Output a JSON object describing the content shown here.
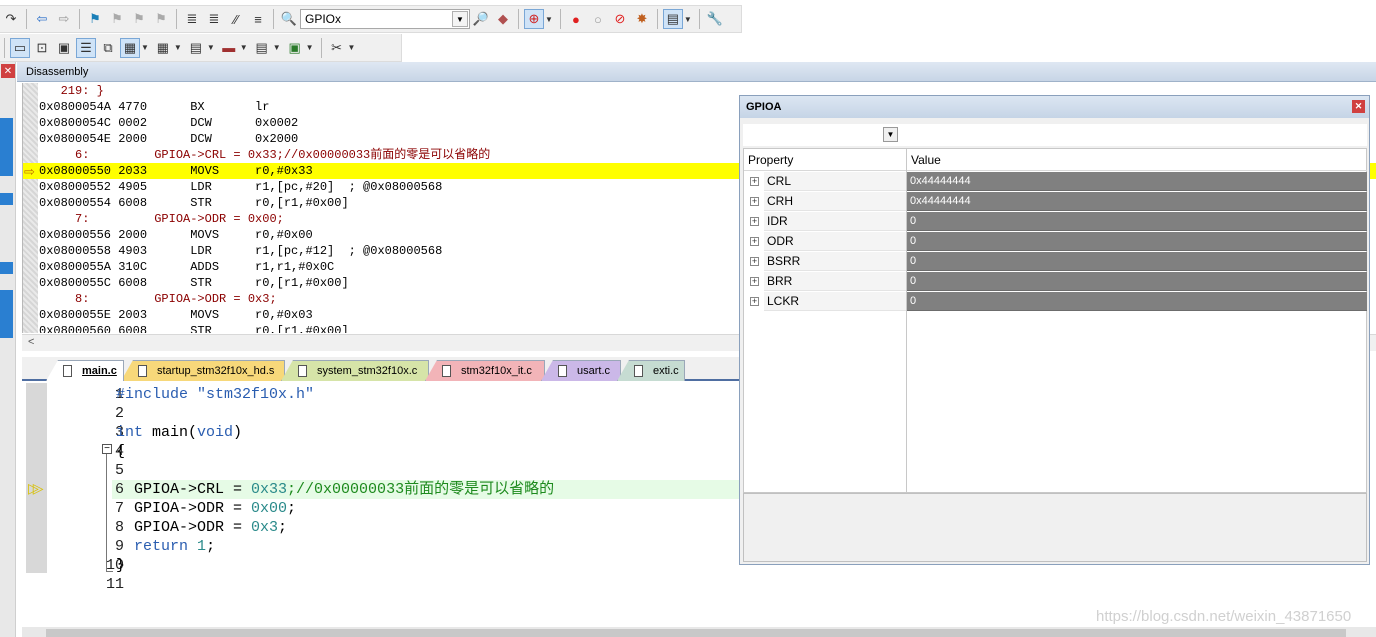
{
  "toolbar1": {
    "target_combo": "GPIOx",
    "icons": [
      "redo-icon",
      "back-icon",
      "forward-icon",
      "bookmark-icon",
      "prev-bookmark-icon",
      "next-bookmark-icon",
      "clear-bookmarks-icon",
      "indent-icon",
      "unindent-icon",
      "comment-icon",
      "uncomment-icon",
      "find-in-files-icon",
      "find-icon",
      "debug-session-icon",
      "breakpoint-icon",
      "disable-breakpoint-icon",
      "disable-all-breakpoints-icon",
      "kill-breakpoints-icon",
      "window-layout-icon",
      "configure-icon"
    ]
  },
  "toolbar2": {
    "icons": [
      "command-window-icon",
      "disassembly-window-icon",
      "symbols-window-icon",
      "registers-window-icon",
      "call-stack-icon",
      "watch-window-icon",
      "memory-window-icon",
      "serial-window-icon",
      "analysis-window-icon",
      "trace-window-icon",
      "system-viewer-icon",
      "toolbox-icon"
    ]
  },
  "disassembly": {
    "title": "Disassembly",
    "lines": [
      {
        "text": "   219: }",
        "kind": "src"
      },
      {
        "text": "0x0800054A 4770      BX       lr",
        "kind": "asm"
      },
      {
        "text": "0x0800054C 0002      DCW      0x0002",
        "kind": "asm"
      },
      {
        "text": "0x0800054E 2000      DCW      0x2000",
        "kind": "asm"
      },
      {
        "text": "     6:         GPIOA->CRL = 0x33;//0x00000033前面的零是可以省略的",
        "kind": "src"
      },
      {
        "text": "0x08000550 2033      MOVS     r0,#0x33",
        "kind": "cur"
      },
      {
        "text": "0x08000552 4905      LDR      r1,[pc,#20]  ; @0x08000568",
        "kind": "asm"
      },
      {
        "text": "0x08000554 6008      STR      r0,[r1,#0x00]",
        "kind": "asm"
      },
      {
        "text": "     7:         GPIOA->ODR = 0x00;",
        "kind": "src"
      },
      {
        "text": "0x08000556 2000      MOVS     r0,#0x00",
        "kind": "asm"
      },
      {
        "text": "0x08000558 4903      LDR      r1,[pc,#12]  ; @0x08000568",
        "kind": "asm"
      },
      {
        "text": "0x0800055A 310C      ADDS     r1,r1,#0x0C",
        "kind": "asm"
      },
      {
        "text": "0x0800055C 6008      STR      r0,[r1,#0x00]",
        "kind": "asm"
      },
      {
        "text": "     8:         GPIOA->ODR = 0x3;",
        "kind": "src"
      },
      {
        "text": "0x0800055E 2003      MOVS     r0,#0x03",
        "kind": "asm"
      },
      {
        "text": "0x08000560 6008      STR      r0,[r1,#0x00]",
        "kind": "asm"
      }
    ]
  },
  "tabs": [
    {
      "label": "main.c",
      "color": "#ffffff",
      "active": true
    },
    {
      "label": "startup_stm32f10x_hd.s",
      "color": "#f7d87a",
      "active": false
    },
    {
      "label": "system_stm32f10x.c",
      "color": "#d6e4a8",
      "active": false
    },
    {
      "label": "stm32f10x_it.c",
      "color": "#f2b4b8",
      "active": false
    },
    {
      "label": "usart.c",
      "color": "#cbb8e8",
      "active": false
    },
    {
      "label": "exti.c",
      "color": "#c6dcd2",
      "active": false
    }
  ],
  "editor": {
    "line_numbers": [
      "1",
      "2",
      "3",
      "4",
      "5",
      "6",
      "7",
      "8",
      "9",
      "10",
      "11"
    ],
    "lines": [
      [
        {
          "t": "#include \"stm32f10x.h\"",
          "c": "pp"
        }
      ],
      [],
      [
        {
          "t": "int",
          "c": "kw"
        },
        {
          "t": " main(",
          "c": ""
        },
        {
          "t": "void",
          "c": "kw"
        },
        {
          "t": ")",
          "c": ""
        }
      ],
      [
        {
          "t": "{",
          "c": ""
        }
      ],
      [],
      [
        {
          "t": "  GPIOA->CRL = ",
          "c": ""
        },
        {
          "t": "0x33",
          "c": "num"
        },
        {
          "t": ";//0x00000033前面的零是可以省略的",
          "c": "cm"
        }
      ],
      [
        {
          "t": "  GPIOA->ODR = ",
          "c": ""
        },
        {
          "t": "0x00",
          "c": "num"
        },
        {
          "t": ";",
          "c": ""
        }
      ],
      [
        {
          "t": "  GPIOA->ODR = ",
          "c": ""
        },
        {
          "t": "0x3",
          "c": "num"
        },
        {
          "t": ";",
          "c": ""
        }
      ],
      [
        {
          "t": "  ",
          "c": ""
        },
        {
          "t": "return",
          "c": "kw"
        },
        {
          "t": " ",
          "c": ""
        },
        {
          "t": "1",
          "c": "num"
        },
        {
          "t": ";",
          "c": ""
        }
      ],
      [
        {
          "t": "}",
          "c": ""
        }
      ],
      []
    ]
  },
  "gpio": {
    "title": "GPIOA",
    "col_property": "Property",
    "col_value": "Value",
    "rows": [
      {
        "name": "CRL",
        "value": "0x44444444"
      },
      {
        "name": "CRH",
        "value": "0x44444444"
      },
      {
        "name": "IDR",
        "value": "0"
      },
      {
        "name": "ODR",
        "value": "0"
      },
      {
        "name": "BSRR",
        "value": "0"
      },
      {
        "name": "BRR",
        "value": "0"
      },
      {
        "name": "LCKR",
        "value": "0"
      }
    ]
  },
  "watermark": "https://blog.csdn.net/weixin_43871650"
}
